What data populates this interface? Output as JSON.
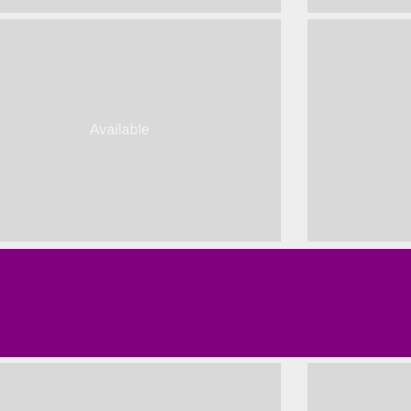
{
  "tiles": {
    "main": {
      "label": "Available"
    }
  },
  "bar": {
    "color": "#800080"
  },
  "colors": {
    "background": "#eeeeee",
    "tile": "#d9d9d9",
    "label": "#f4f4f4"
  }
}
